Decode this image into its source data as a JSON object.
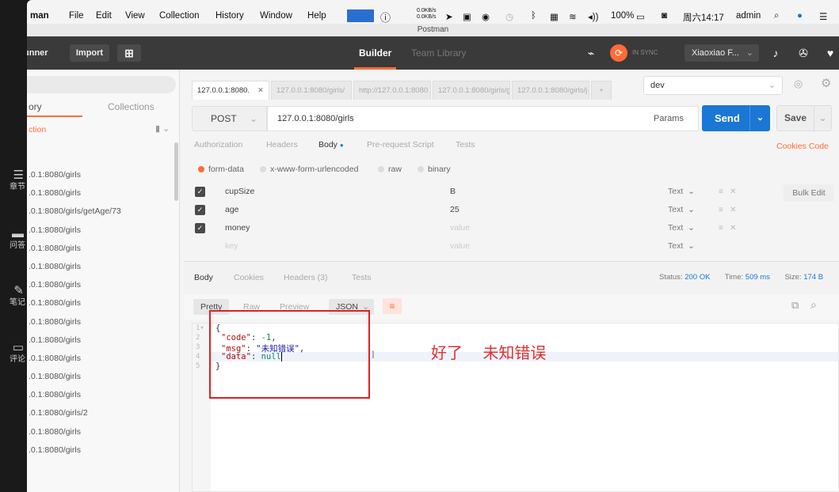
{
  "left_strip": {
    "items": [
      {
        "icon": "list-icon",
        "label": "章节"
      },
      {
        "icon": "chat-icon",
        "label": "问答"
      },
      {
        "icon": "pen-icon",
        "label": "笔记"
      },
      {
        "icon": "comment-icon",
        "label": "评论"
      }
    ]
  },
  "menubar": {
    "app": "man",
    "items": [
      "File",
      "Edit",
      "View",
      "Collection",
      "History",
      "Window",
      "Help"
    ],
    "net_up": "0.0KB/s",
    "net_down": "0.0KB/s",
    "battery": "100%",
    "clock": "周六14:17",
    "user": "admin"
  },
  "window_title": "Postman",
  "toolbar": {
    "runner": "unner",
    "import": "Import",
    "builder": "Builder",
    "team_library": "Team Library",
    "sync_status": "IN SYNC",
    "user_menu": "Xiaoxiao F..."
  },
  "sidebar": {
    "tab_history": "ory",
    "tab_collections": "Collections",
    "action": "ction",
    "history": [
      ".0.1:8080/girls",
      ".0.1:8080/girls",
      ".0.1:8080/girls/getAge/73",
      ".0.1:8080/girls",
      ".0.1:8080/girls",
      ".0.1:8080/girls",
      ".0.1:8080/girls",
      ".0.1:8080/girls",
      ".0.1:8080/girls",
      ".0.1:8080/girls",
      ".0.1:8080/girls",
      ".0.1:8080/girls",
      ".0.1:8080/girls",
      ".0.1:8080/girls/2",
      ".0.1:8080/girls",
      ".0.1:8080/girls"
    ]
  },
  "request_tabs": [
    "127.0.0.1:8080.",
    "127.0.0.1:8080/girls/",
    "http://127.0.0.1:8080",
    "127.0.0.1:8080/girls/g",
    "127.0.0.1:8080/girls/j"
  ],
  "environment": "dev",
  "request": {
    "method": "POST",
    "url": "127.0.0.1:8080/girls",
    "params_label": "Params",
    "send_label": "Send",
    "save_label": "Save"
  },
  "request_subtabs": [
    "Authorization",
    "Headers",
    "Body",
    "Pre-request Script",
    "Tests"
  ],
  "cookies_code": "Cookies  Code",
  "body_types": [
    "form-data",
    "x-www-form-urlencoded",
    "raw",
    "binary"
  ],
  "form_rows": [
    {
      "key": "cupSize",
      "value": "B",
      "type": "Text"
    },
    {
      "key": "age",
      "value": "25",
      "type": "Text"
    },
    {
      "key": "money",
      "value": "value",
      "type": "Text"
    },
    {
      "key": "key",
      "value": "value",
      "type": "Text"
    }
  ],
  "bulk_edit": "Bulk Edit",
  "response": {
    "tabs": [
      "Body",
      "Cookies",
      "Headers (3)",
      "Tests"
    ],
    "status_label": "Status:",
    "status": "200 OK",
    "time_label": "Time:",
    "time": "509 ms",
    "size_label": "Size:",
    "size": "174 B",
    "formats": [
      "Pretty",
      "Raw",
      "Preview"
    ],
    "format_select": "JSON",
    "code": {
      "l1": "{",
      "code_key": "\"code\"",
      "code_val": "-1",
      "msg_key": "\"msg\"",
      "msg_val": "\"未知错误\"",
      "data_key": "\"data\"",
      "data_val": "null",
      "l5": "}"
    }
  },
  "annotation": "好了    未知错误"
}
